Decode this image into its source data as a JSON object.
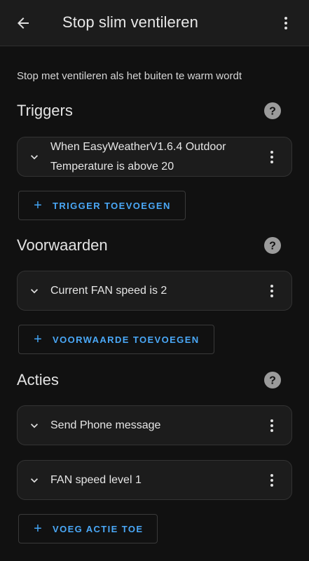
{
  "header": {
    "title": "Stop slim ventileren",
    "back_icon": "arrow-left-icon",
    "menu_icon": "more-vertical-icon"
  },
  "description": "Stop met ventileren als het buiten te warm wordt",
  "sections": {
    "triggers": {
      "title": "Triggers",
      "items": [
        {
          "line1": "When EasyWeatherV1.6.4 Outdoor",
          "line2": "Temperature is above 20"
        }
      ],
      "add_label": "TRIGGER TOEVOEGEN"
    },
    "conditions": {
      "title": "Voorwaarden",
      "items": [
        {
          "label": "Current FAN speed is 2"
        }
      ],
      "add_label": "VOORWAARDE TOEVOEGEN"
    },
    "actions": {
      "title": "Acties",
      "items": [
        {
          "label": "Send Phone message"
        },
        {
          "label": "FAN speed level 1"
        }
      ],
      "add_label": "VOEG ACTIE TOE"
    }
  },
  "colors": {
    "accent": "#43a5f5",
    "background": "#111111",
    "card": "#1c1c1c"
  }
}
